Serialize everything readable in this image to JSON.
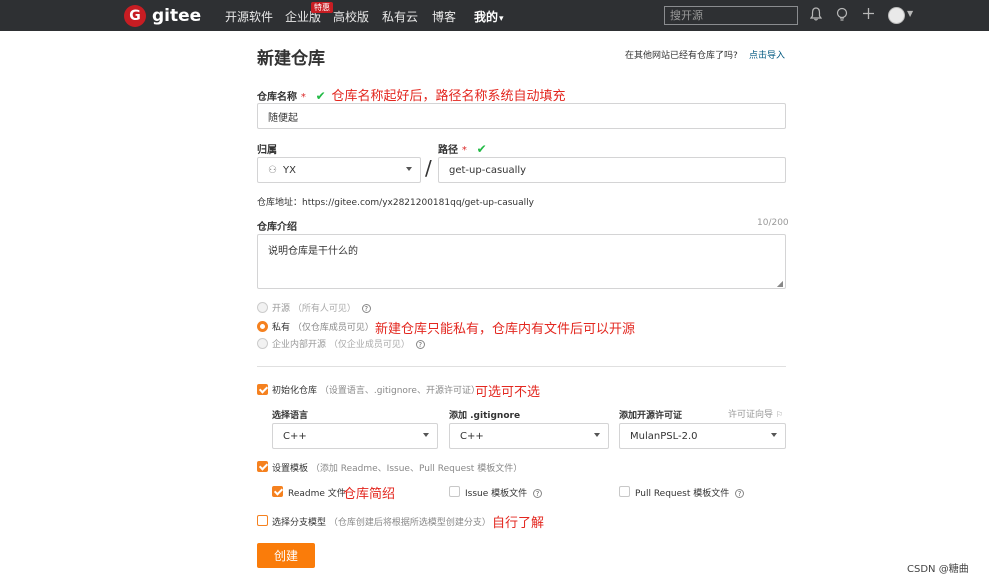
{
  "nav": {
    "logo_text": "gitee",
    "logo_letter": "G",
    "items": [
      "开源软件",
      "企业版",
      "高校版",
      "私有云",
      "博客",
      "我的"
    ],
    "badge": "特惠",
    "search_placeholder": "搜开源",
    "my_caret": "▾"
  },
  "page": {
    "title": "新建仓库",
    "import_question": "在其他网站已经有仓库了吗?",
    "import_link": "点击导入"
  },
  "repo_name": {
    "label": "仓库名称",
    "required_mark": "*",
    "check": "✔",
    "annotation": "仓库名称起好后，路径名称系统自动填充",
    "value": "随便起"
  },
  "owner": {
    "label": "归属",
    "value": "YX",
    "slash": "/"
  },
  "path": {
    "label": "路径",
    "required_mark": "*",
    "check": "✔",
    "value": "get-up-casually"
  },
  "repo_address": "仓库地址：https://gitee.com/yx2821200181qq/get-up-casually",
  "intro": {
    "label": "仓库介绍",
    "counter": "10/200",
    "value": "说明仓库是干什么的"
  },
  "visibility": {
    "options": [
      {
        "label": "开源",
        "desc": "（所有人可见）",
        "selected": false,
        "disabled": true
      },
      {
        "label": "私有",
        "desc": "（仅仓库成员可见）",
        "selected": true,
        "disabled": false
      },
      {
        "label": "企业内部开源",
        "desc": "（仅企业成员可见）",
        "selected": false,
        "disabled": true
      }
    ],
    "annotation": "新建仓库只能私有，仓库内有文件后可以开源"
  },
  "init_repo": {
    "label": "初始化仓库",
    "desc": "（设置语言、.gitignore、开源许可证）",
    "annotation": "可选可不选",
    "checked": true
  },
  "language": {
    "label": "选择语言",
    "value": "C++"
  },
  "gitignore": {
    "label": "添加 .gitignore",
    "value": "C++"
  },
  "license": {
    "label": "添加开源许可证",
    "value": "MulanPSL-2.0",
    "guide": "许可证向导"
  },
  "template": {
    "label": "设置模板",
    "desc": "（添加 Readme、Issue、Pull Request 模板文件）",
    "checked": true,
    "readme": "Readme 文件",
    "readme_annotation": "仓库简绍",
    "issue": "Issue 模板文件",
    "pr": "Pull Request 模板文件"
  },
  "branch_model": {
    "label": "选择分支模型",
    "desc": "（仓库创建后将根据所选模型创建分支）",
    "annotation": "自行了解",
    "checked": false
  },
  "create_button": "创建",
  "watermark": "CSDN @糖曲",
  "colors": {
    "nav_bg": "#2e3033",
    "accent": "#f5811f",
    "button": "#fa7c0a",
    "annotation": "#e3271f",
    "check": "#21ba45",
    "logo": "#c71d23"
  }
}
